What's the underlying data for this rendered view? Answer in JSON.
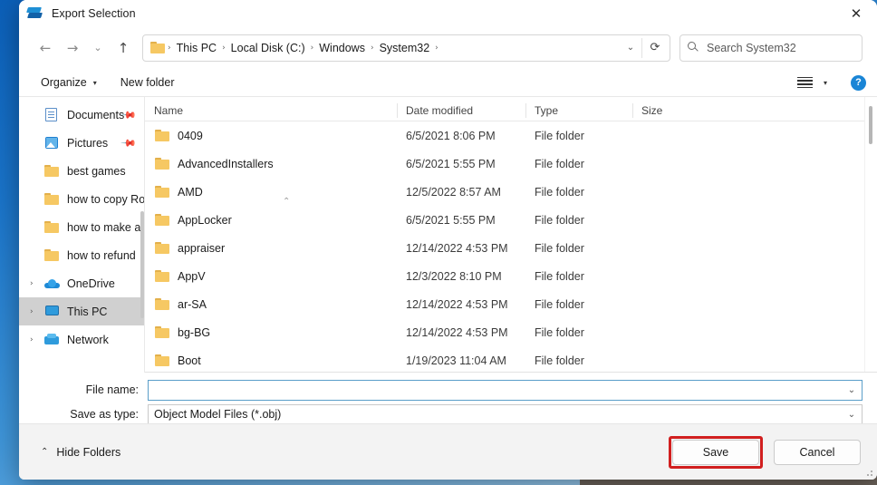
{
  "window": {
    "title": "Export Selection",
    "app_icon": "export-layers-icon",
    "close_label": "✕"
  },
  "nav": {
    "back_icon": "←",
    "forward_icon": "→",
    "recent_icon": "⌄",
    "up_icon": "↑",
    "refresh_icon": "⟳",
    "dropdown_icon": "⌄",
    "breadcrumbs": [
      "This PC",
      "Local Disk (C:)",
      "Windows",
      "System32"
    ],
    "separator": "›"
  },
  "search": {
    "placeholder": "Search System32",
    "value": "",
    "icon": "search-icon"
  },
  "toolbar": {
    "organize_label": "Organize",
    "organize_caret": "▾",
    "new_folder_label": "New folder",
    "view_caret": "▾",
    "help_label": "?"
  },
  "sidebar": {
    "items": [
      {
        "label": "Documents",
        "icon": "document-icon",
        "chevron": "",
        "pinned": true,
        "selected": false
      },
      {
        "label": "Pictures",
        "icon": "picture-icon",
        "chevron": "",
        "pinned": true,
        "selected": false
      },
      {
        "label": "best games",
        "icon": "folder-icon",
        "chevron": "",
        "pinned": false,
        "selected": false
      },
      {
        "label": "how to copy Ro",
        "icon": "folder-icon",
        "chevron": "",
        "pinned": false,
        "selected": false
      },
      {
        "label": "how to make a",
        "icon": "folder-icon",
        "chevron": "",
        "pinned": false,
        "selected": false
      },
      {
        "label": "how to refund",
        "icon": "folder-icon",
        "chevron": "",
        "pinned": false,
        "selected": false
      },
      {
        "label": "OneDrive",
        "icon": "cloud-icon",
        "chevron": "›",
        "pinned": false,
        "selected": false
      },
      {
        "label": "This PC",
        "icon": "computer-icon",
        "chevron": "›",
        "pinned": false,
        "selected": true
      },
      {
        "label": "Network",
        "icon": "network-icon",
        "chevron": "›",
        "pinned": false,
        "selected": false
      }
    ]
  },
  "filelist": {
    "sort_indicator": "⌃",
    "columns": [
      "Name",
      "Date modified",
      "Type",
      "Size"
    ],
    "rows": [
      {
        "name": "0409",
        "date": "6/5/2021 8:06 PM",
        "type": "File folder",
        "size": ""
      },
      {
        "name": "AdvancedInstallers",
        "date": "6/5/2021 5:55 PM",
        "type": "File folder",
        "size": ""
      },
      {
        "name": "AMD",
        "date": "12/5/2022 8:57 AM",
        "type": "File folder",
        "size": ""
      },
      {
        "name": "AppLocker",
        "date": "6/5/2021 5:55 PM",
        "type": "File folder",
        "size": ""
      },
      {
        "name": "appraiser",
        "date": "12/14/2022 4:53 PM",
        "type": "File folder",
        "size": ""
      },
      {
        "name": "AppV",
        "date": "12/3/2022 8:10 PM",
        "type": "File folder",
        "size": ""
      },
      {
        "name": "ar-SA",
        "date": "12/14/2022 4:53 PM",
        "type": "File folder",
        "size": ""
      },
      {
        "name": "bg-BG",
        "date": "12/14/2022 4:53 PM",
        "type": "File folder",
        "size": ""
      },
      {
        "name": "Boot",
        "date": "1/19/2023 11:04 AM",
        "type": "File folder",
        "size": ""
      }
    ]
  },
  "form": {
    "filename_label": "File name:",
    "filename_value": "",
    "filename_chevron": "⌄",
    "savetype_label": "Save as type:",
    "savetype_value": "Object Model Files (*.obj)",
    "savetype_chevron": "⌄"
  },
  "footer": {
    "hide_folders_label": "Hide Folders",
    "hide_folders_caret": "⌃",
    "save_label": "Save",
    "cancel_label": "Cancel"
  },
  "colors": {
    "highlight_red": "#d11f1f",
    "accent_blue": "#1a85d6",
    "selection_gray": "#d0d0d0",
    "folder_yellow": "#f6c863"
  }
}
